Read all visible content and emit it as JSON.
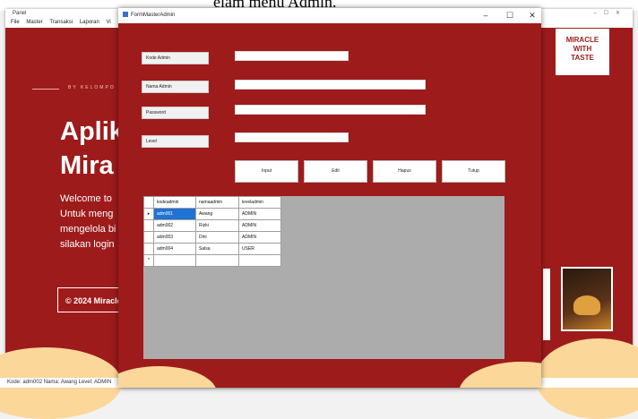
{
  "document_caption": "elam menu Admin.",
  "main_window": {
    "title": "Panel",
    "menu": [
      "File",
      "Master",
      "Transaksi",
      "Laporan",
      "Vi"
    ],
    "hero_subtitle": "BY KELOMPO",
    "hero_title_line1": "Aplik",
    "hero_title_line2": "Mira",
    "hero_desc": [
      "Welcome to",
      "Untuk meng",
      "mengelola bi",
      "silakan login"
    ],
    "copyright": "© 2024 Miracle",
    "logo_lines": [
      "MIRACLE",
      "WITH",
      "TASTE"
    ],
    "status_bar": "Kode: adm002 Nama: Awang Level: ADMIN"
  },
  "form": {
    "title": "FormMasterAdmin",
    "window_controls": {
      "minimize": "–",
      "maximize": "☐",
      "close": "✕"
    },
    "labels": {
      "kode": "Kode Admin",
      "nama": "Nama Admin",
      "password": "Password",
      "level": "Level"
    },
    "buttons": {
      "input": "Input",
      "edit": "Edit",
      "hapus": "Hapus",
      "tutup": "Tutup"
    },
    "grid": {
      "columns": [
        "kodeadmin",
        "namaadmin",
        "leveladmin"
      ],
      "rows": [
        {
          "kode": "adm001",
          "nama": "Awang",
          "level": "ADMIN"
        },
        {
          "kode": "adm002",
          "nama": "Rizki",
          "level": "ADMIN"
        },
        {
          "kode": "adm003",
          "nama": "Dini",
          "level": "ADMIN"
        },
        {
          "kode": "adm004",
          "nama": "Salsa",
          "level": "USER"
        }
      ],
      "current_row_marker": "▸",
      "new_row_marker": "*"
    }
  },
  "colors": {
    "brand_red": "#9e1b1b",
    "accent_cream": "#fbd79a",
    "selection_blue": "#1f73d2",
    "grid_bg": "#acacac"
  }
}
